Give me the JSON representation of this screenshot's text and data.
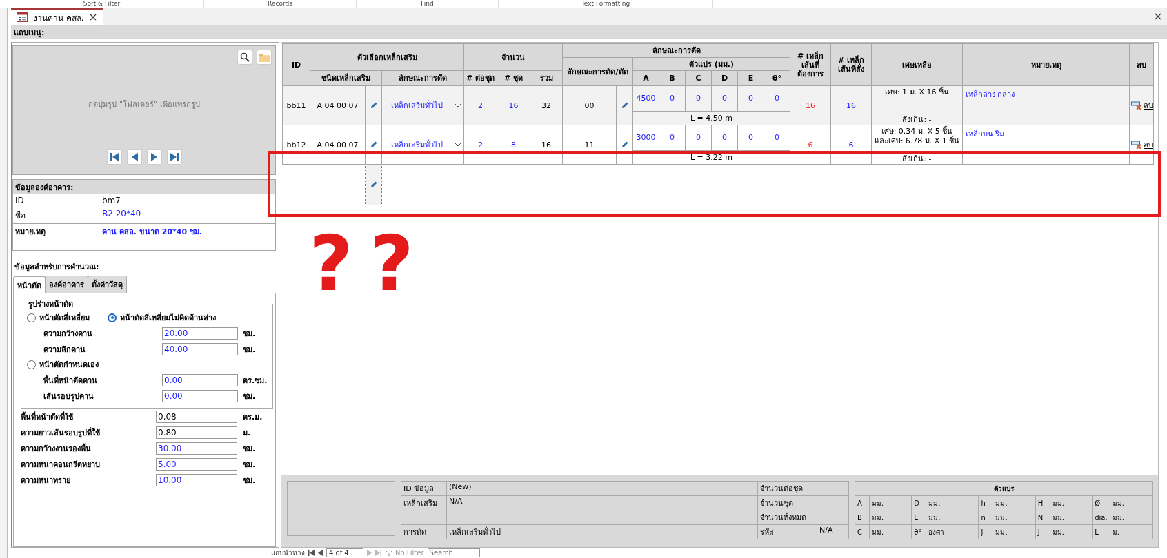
{
  "ribbon": {
    "groups": [
      "Sort & Filter",
      "Records",
      "Find",
      "Text Formatting"
    ]
  },
  "document_tab": {
    "title": "งานคาน คสล."
  },
  "menu_bar": {
    "label": "แถบเมนู:"
  },
  "picture_panel": {
    "hint": "กดปุ่มรูป \"โฟลเดอร์\" เพื่อแทรกรูป"
  },
  "building_info": {
    "title": "ข้อมูลองค์อาคาร:",
    "rows": [
      {
        "label": "ID",
        "value": "bm7",
        "kind": "plain"
      },
      {
        "label": "ชื่อ",
        "value": "B2 20*40",
        "kind": "link"
      },
      {
        "label": "หมายเหตุ",
        "value": "คาน คสล. ขนาด 20*40 ชม.",
        "kind": "memo"
      }
    ]
  },
  "calc": {
    "title": "ข้อมูลสำหรับการคำนวณ:",
    "tabs": [
      {
        "label": "หน้าตัด",
        "selected": true
      },
      {
        "label": "องค์อาคาร",
        "selected": false
      },
      {
        "label": "ตั้งค่าวัสดุ",
        "selected": false
      }
    ],
    "group": {
      "title": "รูปร่างหน้าตัด",
      "items": [
        {
          "kind": "radios",
          "options": [
            {
              "label": "หน้าตัดสี่เหลี่ยม",
              "selected": false
            },
            {
              "label": "หน้าตัดสี่เหลี่ยมไม่คิดด้านล่าง",
              "selected": true
            }
          ]
        },
        {
          "kind": "field",
          "label": "ความกว้างคาน",
          "value": "20.00",
          "unit": "ชม.",
          "editable": true
        },
        {
          "kind": "field",
          "label": "ความลึกคาน",
          "value": "40.00",
          "unit": "ชม.",
          "editable": true
        },
        {
          "kind": "radios",
          "options": [
            {
              "label": "หน้าตัดกำหนดเอง",
              "selected": false
            }
          ]
        },
        {
          "kind": "field",
          "label": "พื้นที่หน้าตัดคาน",
          "value": "0.00",
          "unit": "ตร.ซม.",
          "editable": true
        },
        {
          "kind": "field",
          "label": "เส้นรอบรูปคาน",
          "value": "0.00",
          "unit": "ชม.",
          "editable": true
        }
      ]
    },
    "fields": [
      {
        "label": "พื้นที่หน้าตัดที่ใช้",
        "value": "0.08",
        "unit": "ตร.ม.",
        "editable": false
      },
      {
        "label": "ความยาวเส้นรอบรูปที่ใช้",
        "value": "0.80",
        "unit": "ม.",
        "editable": false
      },
      {
        "label": "ความกว้างงานรองพื้น",
        "value": "30.00",
        "unit": "ชม.",
        "editable": true
      },
      {
        "label": "ความหนาคอนกรีตหยาบ",
        "value": "5.00",
        "unit": "ชม.",
        "editable": true
      },
      {
        "label": "ความหนาทราย",
        "value": "10.00",
        "unit": "ชม.",
        "editable": true
      }
    ]
  },
  "grid": {
    "headers": {
      "id": "ID",
      "options": "ตัวเลือกเหล็กเสริม",
      "type": "ชนิดเหล็กเสริม",
      "bend": "ลักษณะการดัด",
      "qty": "จำนวน",
      "per_set": "# ต่อชุด",
      "sets": "# ชุด",
      "total": "รวม",
      "cutting": "ลักษณะการตัด",
      "cut": "ลักษณะการตัด/ตัด",
      "params": "ตัวแปร (มม.)",
      "param_names": [
        "A",
        "B",
        "C",
        "D",
        "E",
        "θ°"
      ],
      "need": "# เหล็กเส้นที่ต้องการ",
      "order": "# เหล็กเส้นที่สั่ง",
      "scrap": "เศษเหลือ",
      "note": "หมายเหตุ",
      "delete": "ลบ"
    },
    "rows": [
      {
        "id": "bb11",
        "type": "A 04 00 07",
        "bend": "เหล็กเสริมทั่วไป",
        "per_set": "2",
        "sets": "16",
        "total": "32",
        "cut": "00",
        "params": [
          "4500",
          "0",
          "0",
          "0",
          "0",
          "0"
        ],
        "length": "L = 4.50 m",
        "need": "16",
        "order": "16",
        "scrap": [
          "เศษ: 1 ม. X 16 ชิ้น"
        ],
        "over": "สั่งเกิน: -",
        "note": "เหล็กล่าง กลาง",
        "delete": "ลบ",
        "selected": true
      },
      {
        "id": "bb12",
        "type": "A 04 00 07",
        "bend": "เหล็กเสริมทั่วไป",
        "per_set": "2",
        "sets": "8",
        "total": "16",
        "cut": "11",
        "params": [
          "3000",
          "0",
          "0",
          "0",
          "0",
          "0"
        ],
        "length": "L = 3.22 m",
        "need": "6",
        "order": "6",
        "scrap": [
          "เศษ: 0.34 ม. X 5 ชิ้น",
          "และเศษ: 6.78 ม. X 1 ชิ้น"
        ],
        "over": "สั่งเกิน: -",
        "note": "เหล็กบน ริม",
        "delete": "ลบ",
        "selected": false
      }
    ]
  },
  "detail": {
    "rows": [
      {
        "label": "ID ข้อมูล",
        "value": "(New)",
        "label2": "จำนวนต่อชุด"
      },
      {
        "label": "เหล็กเสริม",
        "value": "N/A",
        "label2": "จำนวนชุด"
      },
      {
        "label2": "จำนวนทั้งหมด"
      },
      {
        "label": "การตัด",
        "value": "เหล็กเสริมทั่วไป",
        "label2": "รหัส",
        "value2": "N/A"
      }
    ],
    "params_title": "ตัวแปร",
    "params": [
      [
        [
          "A",
          "มม."
        ],
        [
          "D",
          "มม."
        ],
        [
          "h",
          "มม."
        ],
        [
          "H",
          "มม."
        ],
        [
          "Ø",
          "มม."
        ]
      ],
      [
        [
          "B",
          "มม."
        ],
        [
          "E",
          "มม."
        ],
        [
          "n",
          "มม."
        ],
        [
          "N",
          "มม."
        ],
        [
          "dia.",
          "มม."
        ]
      ],
      [
        [
          "C",
          "มม."
        ],
        [
          "θ°",
          "องศา"
        ],
        [
          "j",
          "มม."
        ],
        [
          "J",
          "มม."
        ],
        [
          "L",
          "ม."
        ]
      ]
    ]
  },
  "navigator": {
    "label": "แถบนำทาง",
    "position": "4 of 4",
    "filter": "No Filter",
    "search_placeholder": "Search"
  },
  "annotation": {
    "marks": [
      "?",
      "?"
    ]
  }
}
